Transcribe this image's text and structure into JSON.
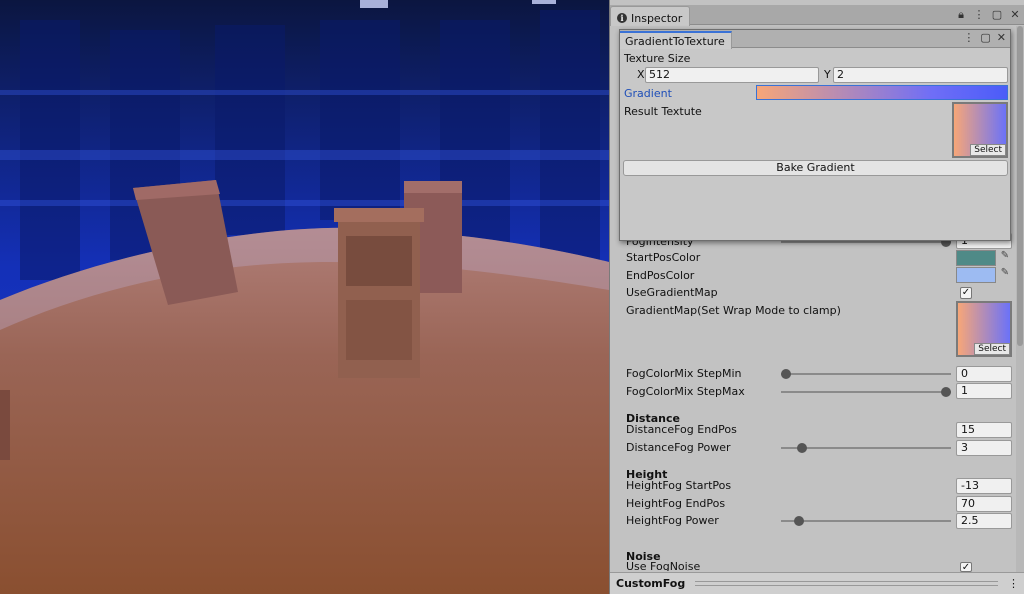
{
  "inspector": {
    "tab_label": "Inspector",
    "icons": [
      "info-icon",
      "lock-icon",
      "more-icon",
      "maximize-icon",
      "close-icon"
    ],
    "fields": {
      "fog_intensity_label": "FogIntensity",
      "fog_intensity_value": "1",
      "start_pos_color_label": "StartPosColor",
      "start_pos_color": "#4f8a87",
      "end_pos_color_label": "EndPosColor",
      "end_pos_color": "#9dbbf2",
      "use_gradient_map_label": "UseGradientMap",
      "use_gradient_map_checked": true,
      "gradient_map_label": "GradientMap(Set Wrap Mode to clamp)",
      "select_label": "Select",
      "fog_color_mix_step_min_label": "FogColorMix StepMin",
      "fog_color_mix_step_min_value": "0",
      "fog_color_mix_step_min_fraction": 0.0,
      "fog_color_mix_step_max_label": "FogColorMix StepMax",
      "fog_color_mix_step_max_value": "1",
      "fog_color_mix_step_max_fraction": 1.0
    },
    "distance": {
      "header": "Distance",
      "end_pos_label": "DistanceFog EndPos",
      "end_pos_value": "15",
      "power_label": "DistanceFog Power",
      "power_value": "3",
      "power_fraction": 0.1
    },
    "height": {
      "header": "Height",
      "start_pos_label": "HeightFog StartPos",
      "start_pos_value": "-13",
      "end_pos_label": "HeightFog EndPos",
      "end_pos_value": "70",
      "power_label": "HeightFog Power",
      "power_value": "2.5",
      "power_fraction": 0.08
    },
    "noise": {
      "header": "Noise",
      "use_fog_noise_label": "Use FogNoise",
      "use_fog_noise_checked": true
    },
    "footer_label": "CustomFog",
    "footer_menu": "⋮"
  },
  "gradient_window": {
    "tab_label": "GradientToTexture",
    "texture_size_label": "Texture Size",
    "x_label": "X",
    "x_value": "512",
    "y_label": "Y",
    "y_value": "2",
    "gradient_label": "Gradient",
    "result_texture_label": "Result Textute",
    "select_label": "Select",
    "bake_button_label": "Bake Gradient",
    "gradient_colors": [
      "#f7a678",
      "#6f6ef7",
      "#4b5cf8"
    ]
  }
}
